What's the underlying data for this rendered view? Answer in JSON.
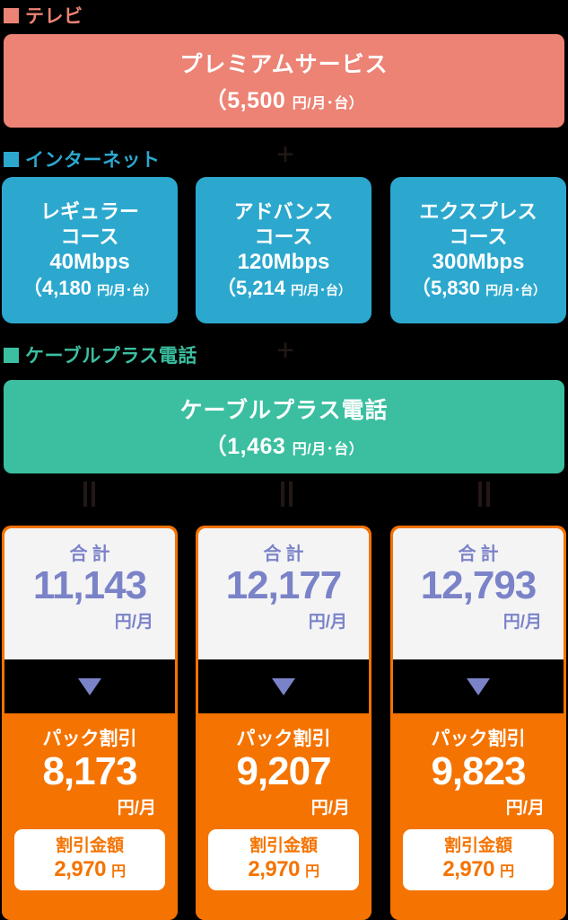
{
  "legends": [
    {
      "name": "テレビ",
      "color": "#EC8375"
    },
    {
      "name": "インターネット",
      "color": "#2CA8CE"
    },
    {
      "name": "ケーブルプラス電話",
      "color": "#3BBFA0"
    }
  ],
  "operators": {
    "plus": "+",
    "equals": "="
  },
  "tv": {
    "title": "プレミアムサービス",
    "price": "（5,500",
    "unit": "円/月･台）"
  },
  "internet": {
    "courses": [
      {
        "name": "レギュラー\nコース",
        "speed": "40Mbps",
        "price": "（4,180",
        "unit": "円/月･台）"
      },
      {
        "name": "アドバンス\nコース",
        "speed": "120Mbps",
        "price": "（5,214",
        "unit": "円/月･台）"
      },
      {
        "name": "エクスプレス\nコース",
        "speed": "300Mbps",
        "price": "（5,830",
        "unit": "円/月･台）"
      }
    ]
  },
  "phone": {
    "title": "ケーブルプラス電話",
    "price": "（1,463",
    "unit": "円/月･台）"
  },
  "results": [
    {
      "total_label": "合計",
      "total_value": "11,143",
      "total_unit": "円/月",
      "discount_label": "パック割引",
      "discount_value": "8,173",
      "discount_unit": "円/月",
      "badge_label": "割引金額",
      "badge_value": "2,970",
      "badge_unit": "円"
    },
    {
      "total_label": "合計",
      "total_value": "12,177",
      "total_unit": "円/月",
      "discount_label": "パック割引",
      "discount_value": "9,207",
      "discount_unit": "円/月",
      "badge_label": "割引金額",
      "badge_value": "2,970",
      "badge_unit": "円"
    },
    {
      "total_label": "合計",
      "total_value": "12,793",
      "total_unit": "円/月",
      "discount_label": "パック割引",
      "discount_value": "9,823",
      "discount_unit": "円/月",
      "badge_label": "割引金額",
      "badge_value": "2,970",
      "badge_unit": "円"
    }
  ],
  "colors": {
    "tv": "#EC8375",
    "internet": "#2CA8CE",
    "phone": "#3BBFA0",
    "orange": "#F57300",
    "purple": "#7B83C8",
    "card_bg": "#F4F4F5",
    "background": "#000000"
  }
}
